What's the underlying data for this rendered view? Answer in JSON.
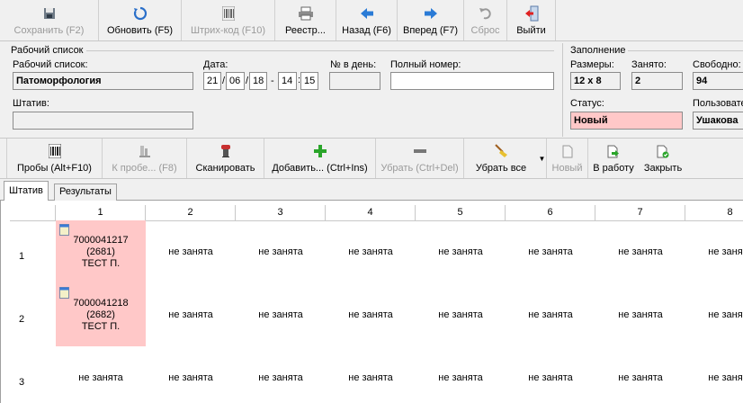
{
  "toolbar_top": [
    {
      "name": "save-button",
      "icon": "floppy-disk-icon",
      "label": "Сохранить (F2)",
      "disabled": true
    },
    {
      "name": "refresh-button",
      "icon": "refresh-icon",
      "label": "Обновить (F5)",
      "disabled": false
    },
    {
      "name": "barcode-button",
      "icon": "barcode-icon",
      "label": "Штрих-код (F10)",
      "disabled": true
    },
    {
      "name": "registry-button",
      "icon": "printer-icon",
      "label": "Реестр...",
      "disabled": false
    },
    {
      "name": "back-button",
      "icon": "arrow-left-icon",
      "label": "Назад (F6)",
      "disabled": false
    },
    {
      "name": "forward-button",
      "icon": "arrow-right-icon",
      "label": "Вперед (F7)",
      "disabled": false
    },
    {
      "name": "reset-button",
      "icon": "undo-icon",
      "label": "Сброс",
      "disabled": true
    },
    {
      "name": "exit-button",
      "icon": "exit-door-icon",
      "label": "Выйти",
      "disabled": false
    }
  ],
  "worklist": {
    "group_title": "Рабочий список",
    "worklist_label": "Рабочий список:",
    "worklist_value": "Патоморфология",
    "date_label": "Дата:",
    "date_day": "21",
    "date_month": "06",
    "date_year": "18",
    "time_hour": "14",
    "time_min": "15",
    "per_day_label": "№ в день:",
    "per_day_value": "",
    "full_number_label": "Полный номер:",
    "full_number_value": "",
    "rack_label": "Штатив:",
    "rack_value": ""
  },
  "filling": {
    "group_title": "Заполнение",
    "sizes_label": "Размеры:",
    "sizes_value": "12 x 8",
    "occupied_label": "Занято:",
    "occupied_value": "2",
    "free_label": "Свободно:",
    "free_value": "94",
    "status_label": "Статус:",
    "status_value": "Новый",
    "user_label": "Пользовате",
    "user_value": "Ушакова"
  },
  "toolbar_mid": [
    {
      "name": "samples-button",
      "icon": "barcode-icon",
      "label": "Пробы (Alt+F10)",
      "disabled": false
    },
    {
      "name": "to-sample-button",
      "icon": "lab-icon",
      "label": "К пробе... (F8)",
      "disabled": true
    },
    {
      "name": "scan-button",
      "icon": "scanner-icon",
      "label": "Сканировать",
      "disabled": false
    },
    {
      "name": "add-button",
      "icon": "plus-icon",
      "label": "Добавить... (Ctrl+Ins)",
      "disabled": false
    },
    {
      "name": "remove-button",
      "icon": "minus-icon",
      "label": "Убрать (Ctrl+Del)",
      "disabled": true
    },
    {
      "name": "remove-all-button",
      "icon": "broom-icon",
      "label": "Убрать все",
      "disabled": false
    },
    {
      "name": "new-button",
      "icon": "new-document-icon",
      "label": "Новый",
      "disabled": true
    },
    {
      "name": "to-work-button",
      "icon": "document-arrow-icon",
      "label": "В работу",
      "disabled": false
    },
    {
      "name": "close-button",
      "icon": "document-check-icon",
      "label": "Закрыть",
      "disabled": false
    }
  ],
  "tabs": [
    "Штатив",
    "Результаты"
  ],
  "grid": {
    "columns": [
      "1",
      "2",
      "3",
      "4",
      "5",
      "6",
      "7",
      "8"
    ],
    "rows": [
      "1",
      "2",
      "3"
    ],
    "empty_label": "не занята",
    "occupied": [
      {
        "row": 0,
        "col": 0,
        "line1": "7000041217",
        "line2": "(2681)",
        "line3": "ТЕСТ П."
      },
      {
        "row": 1,
        "col": 0,
        "line1": "7000041218",
        "line2": "(2682)",
        "line3": "ТЕСТ П."
      }
    ]
  },
  "colors": {
    "occupied_cell": "#ffc8c8",
    "status_new": "#ffc8c8"
  }
}
